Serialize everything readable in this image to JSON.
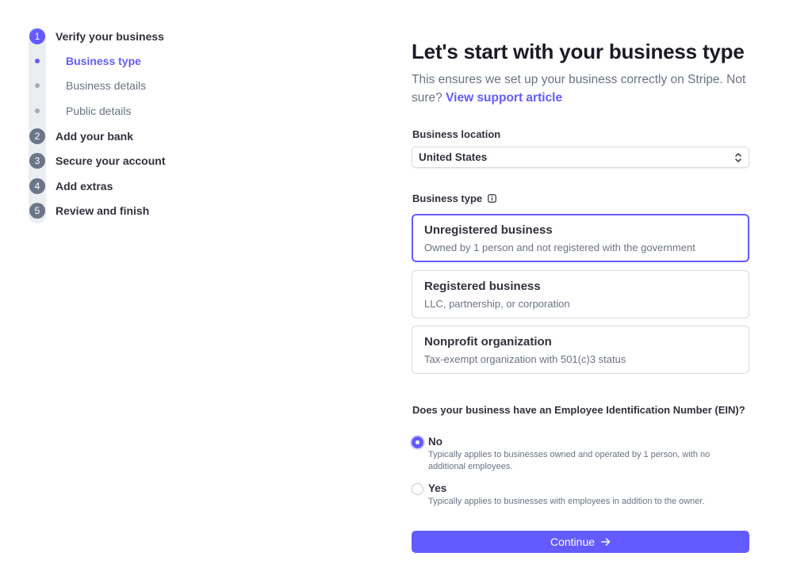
{
  "stepper": {
    "steps": [
      {
        "number": "1",
        "label": "Verify your business"
      },
      {
        "number": "2",
        "label": "Add your bank"
      },
      {
        "number": "3",
        "label": "Secure your account"
      },
      {
        "number": "4",
        "label": "Add extras"
      },
      {
        "number": "5",
        "label": "Review and finish"
      }
    ],
    "substeps": [
      {
        "label": "Business type"
      },
      {
        "label": "Business details"
      },
      {
        "label": "Public details"
      }
    ]
  },
  "page": {
    "title": "Let's start with your business type",
    "subtitle": "This ensures we set up your business correctly on Stripe. Not sure?",
    "support_link": "View support article"
  },
  "location": {
    "label": "Business location",
    "value": "United States"
  },
  "business_type": {
    "label": "Business type",
    "options": [
      {
        "title": "Unregistered business",
        "description": "Owned by 1 person and not registered with the government"
      },
      {
        "title": "Registered business",
        "description": "LLC, partnership, or corporation"
      },
      {
        "title": "Nonprofit organization",
        "description": "Tax-exempt organization with 501(c)3 status"
      }
    ]
  },
  "ein": {
    "question": "Does your business have an Employee Identification Number (EIN)?",
    "options": [
      {
        "label": "No",
        "description": "Typically applies to businesses owned and operated by 1 person, with no additional employees."
      },
      {
        "label": "Yes",
        "description": "Typically applies to businesses with employees in addition to the owner."
      }
    ]
  },
  "actions": {
    "continue_label": "Continue"
  },
  "colors": {
    "accent": "#635bff",
    "text": "#30313d",
    "muted": "#6a7383",
    "border": "#d5dbe1"
  }
}
